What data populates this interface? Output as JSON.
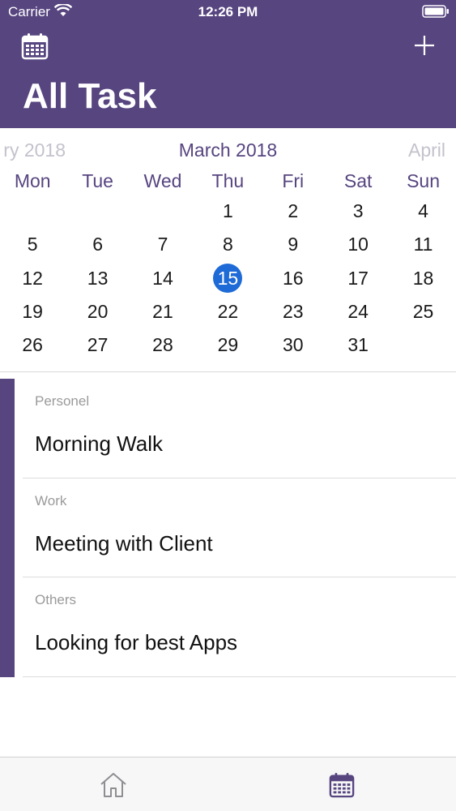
{
  "status_bar": {
    "carrier": "Carrier",
    "time": "12:26 PM"
  },
  "header": {
    "title": "All Task",
    "background_color": "#574580",
    "left_icon": "calendar-icon",
    "right_icon": "plus-icon"
  },
  "calendar": {
    "prev_month_label": "ry 2018",
    "current_month_label": "March 2018",
    "next_month_label": "April",
    "weekdays": [
      "Mon",
      "Tue",
      "Wed",
      "Thu",
      "Fri",
      "Sat",
      "Sun"
    ],
    "weeks": [
      [
        "",
        "",
        "",
        "1",
        "2",
        "3",
        "4"
      ],
      [
        "5",
        "6",
        "7",
        "8",
        "9",
        "10",
        "11"
      ],
      [
        "12",
        "13",
        "14",
        "15",
        "16",
        "17",
        "18"
      ],
      [
        "19",
        "20",
        "21",
        "22",
        "23",
        "24",
        "25"
      ],
      [
        "26",
        "27",
        "28",
        "29",
        "30",
        "31",
        ""
      ]
    ],
    "selected_day": "15",
    "selected_color": "#1e6ad6"
  },
  "tasks": [
    {
      "category": "Personel",
      "name": "Morning Walk"
    },
    {
      "category": "Work",
      "name": "Meeting with Client"
    },
    {
      "category": "Others",
      "name": "Looking for best Apps"
    }
  ],
  "tab_bar": {
    "items": [
      {
        "icon": "home-icon",
        "active": false
      },
      {
        "icon": "calendar-icon",
        "active": true
      }
    ],
    "active_color": "#574580",
    "inactive_color": "#8e8e93"
  }
}
